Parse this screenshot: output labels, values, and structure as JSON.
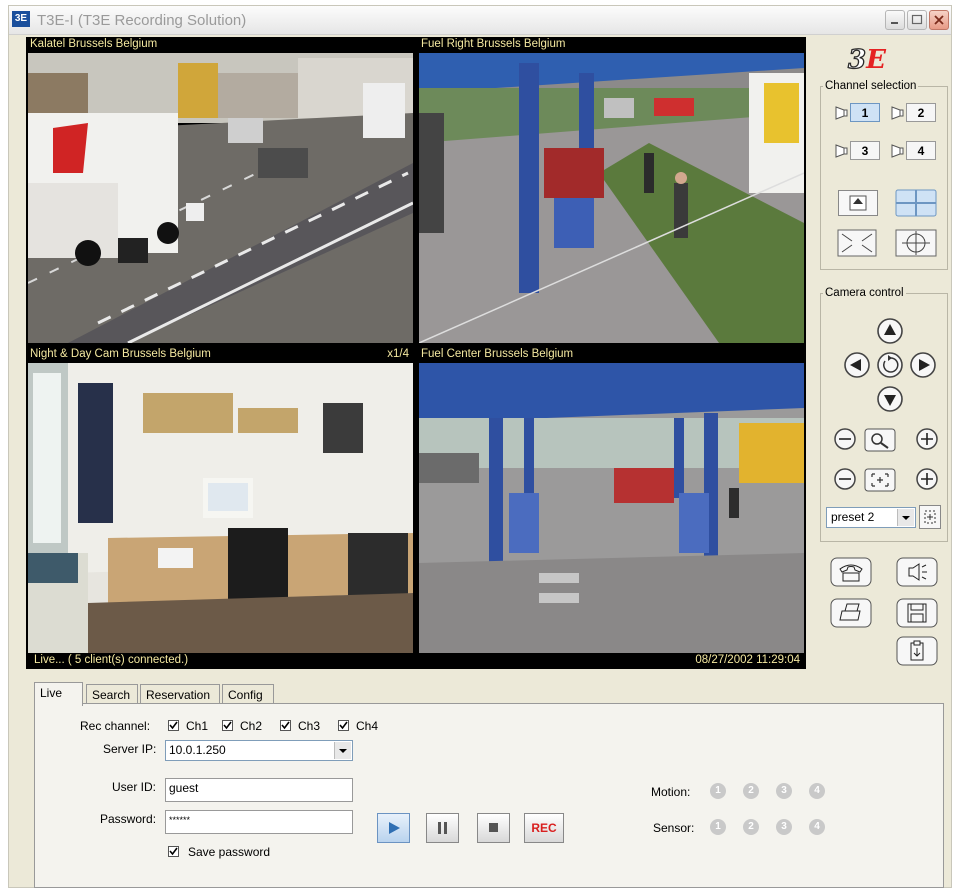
{
  "window": {
    "title": "T3E-I (T3E Recording Solution)",
    "icon_text": "3E"
  },
  "cameras": [
    {
      "label": "Kalatel Brussels Belgium",
      "scene": "highway-traffic"
    },
    {
      "label": "Fuel Right Brussels Belgium",
      "scene": "gas-station-right"
    },
    {
      "label": "Night & Day Cam Brussels Belgium",
      "scene": "office-interior",
      "zoom": "x1/4"
    },
    {
      "label": "Fuel Center Brussels Belgium",
      "scene": "gas-station-center"
    }
  ],
  "status": {
    "left": "Live... ( 5 client(s) connected.)",
    "right": "08/27/2002 11:29:04"
  },
  "logo": {
    "text_main": "3",
    "text_accent": "E"
  },
  "channel_selection": {
    "title": "Channel selection",
    "channels": [
      "1",
      "2",
      "3",
      "4"
    ],
    "active_channel": "1"
  },
  "camera_control": {
    "title": "Camera control",
    "preset_value": "preset 2"
  },
  "tabs": [
    "Live",
    "Search",
    "Reservation",
    "Config"
  ],
  "active_tab": "Live",
  "live": {
    "rec_channel_label": "Rec channel:",
    "rec_channels": [
      {
        "label": "Ch1",
        "checked": true
      },
      {
        "label": "Ch2",
        "checked": true
      },
      {
        "label": "Ch3",
        "checked": true
      },
      {
        "label": "Ch4",
        "checked": true
      }
    ],
    "server_ip_label": "Server IP:",
    "server_ip_value": "10.0.1.250",
    "user_id_label": "User ID:",
    "user_id_value": "guest",
    "password_label": "Password:",
    "password_value": "******",
    "save_password_label": "Save password",
    "save_password_checked": true,
    "rec_button_label": "REC",
    "motion_label": "Motion:",
    "sensor_label": "Sensor:",
    "indicator_numbers": [
      "1",
      "2",
      "3",
      "4"
    ]
  },
  "colors": {
    "overlay_text": "#f4e8a0",
    "rec_red": "#d92020",
    "play_blue": "#2f6fb3",
    "indicator_gray": "#c9c9c9"
  }
}
